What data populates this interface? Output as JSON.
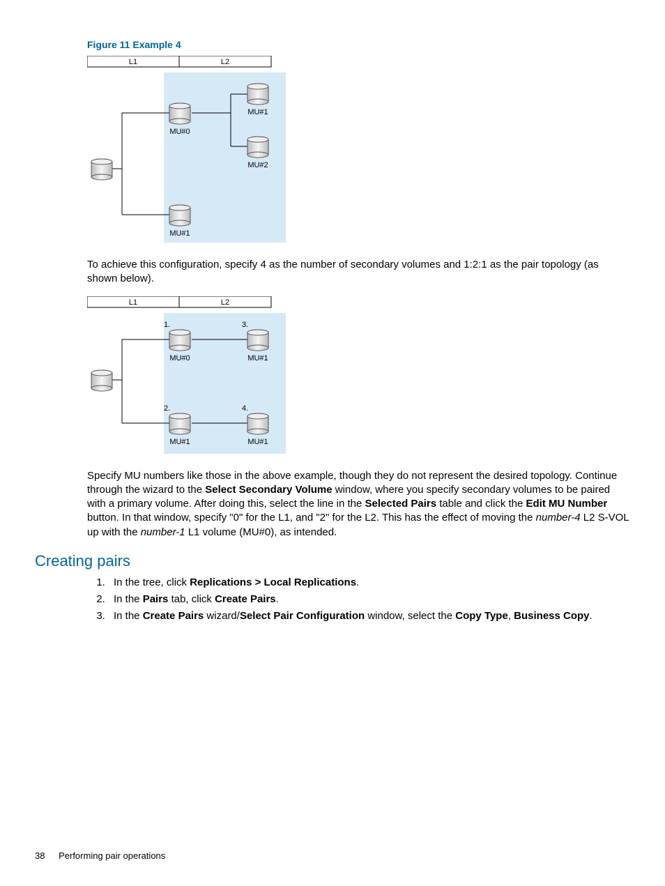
{
  "figure_caption": "Figure 11 Example 4",
  "diagram1": {
    "L1": "L1",
    "L2": "L2",
    "mu0": "MU#0",
    "mu1_top": "MU#1",
    "mu2": "MU#2",
    "mu1_bottom": "MU#1"
  },
  "para1": "To achieve this configuration, specify 4 as the number of secondary volumes and 1:2:1 as the pair topology (as shown below).",
  "diagram2": {
    "L1": "L1",
    "L2": "L2",
    "n1": "1.",
    "mu0": "MU#0",
    "n2": "2.",
    "mu1a": "MU#1",
    "n3": "3.",
    "mu1b": "MU#1",
    "n4": "4.",
    "mu1c": "MU#1"
  },
  "para2_parts": {
    "t1": "Specify MU numbers like those in the above example, though they do not represent the desired topology. Continue through the wizard to the ",
    "b1": "Select Secondary Volume",
    "t2": " window, where you specify secondary volumes to be paired with a primary volume. After doing this, select the line in the ",
    "b2": "Selected Pairs",
    "t3": " table and click the ",
    "b3": "Edit MU Number",
    "t4": " button. In that window, specify \"0\" for the L1, and \"2\" for the L2. This has the effect of moving the ",
    "i1": "number-4",
    "t5": " L2 S-VOL up with the ",
    "i2": "number-1",
    "t6": " L1 volume (MU#0), as intended."
  },
  "section_heading": "Creating pairs",
  "steps": {
    "s1": {
      "t1": "In the tree, click ",
      "b1": "Replications > Local Replications",
      "t2": "."
    },
    "s2": {
      "t1": "In the ",
      "b1": "Pairs",
      "t2": " tab, click ",
      "b2": "Create Pairs",
      "t3": "."
    },
    "s3": {
      "t1": "In the ",
      "b1": "Create Pairs",
      "t2": " wizard/",
      "b2": "Select Pair Configuration",
      "t3": " window, select the ",
      "b3": "Copy Type",
      "t4": ", ",
      "b4": "Business Copy",
      "t5": "."
    }
  },
  "footer": {
    "page": "38",
    "title": "Performing pair operations"
  }
}
